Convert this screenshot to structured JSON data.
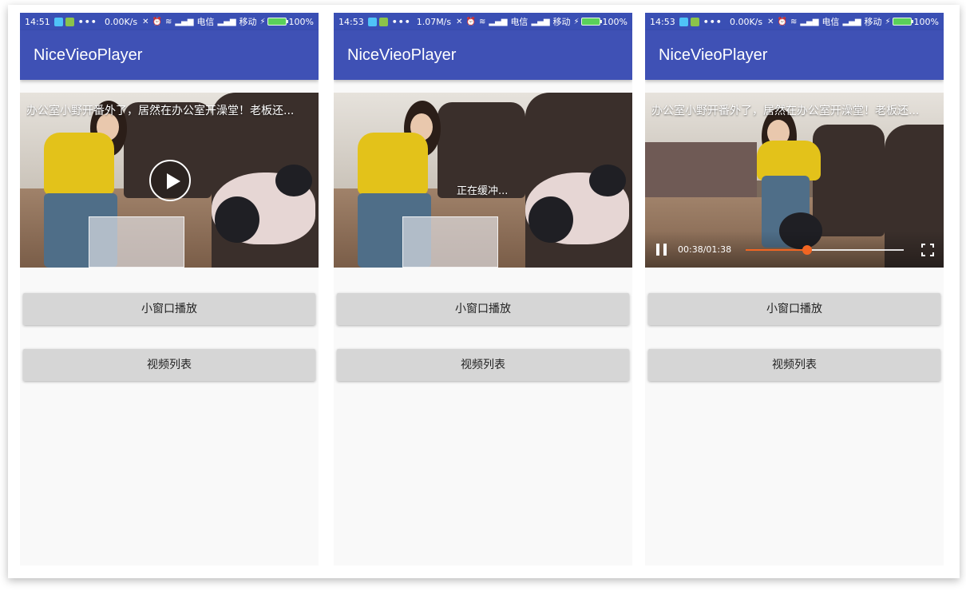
{
  "app_title": "NiceVieoPlayer",
  "video_title": "办公室小野开番外了，居然在办公室开澡堂！老板还...",
  "buttons": {
    "small_window": "小窗口播放",
    "video_list": "视频列表"
  },
  "screens": [
    {
      "status": {
        "time": "14:51",
        "speed": "0.00K/s",
        "carrier": "电信",
        "carrier2": "移动",
        "battery": "100%"
      },
      "state": "idle"
    },
    {
      "status": {
        "time": "14:53",
        "speed": "1.07M/s",
        "carrier": "电信",
        "carrier2": "移动",
        "battery": "100%"
      },
      "state": "buffering",
      "buffering_text": "正在缓冲..."
    },
    {
      "status": {
        "time": "14:53",
        "speed": "0.00K/s",
        "carrier": "电信",
        "carrier2": "移动",
        "battery": "100%"
      },
      "state": "playing",
      "time_text": "00:38/01:38",
      "progress_fraction": 0.388
    }
  ],
  "colors": {
    "status_bar": "#3a4fb4",
    "app_bar": "#3f51b5",
    "seek_accent": "#f26522",
    "button_bg": "#d6d6d6"
  }
}
